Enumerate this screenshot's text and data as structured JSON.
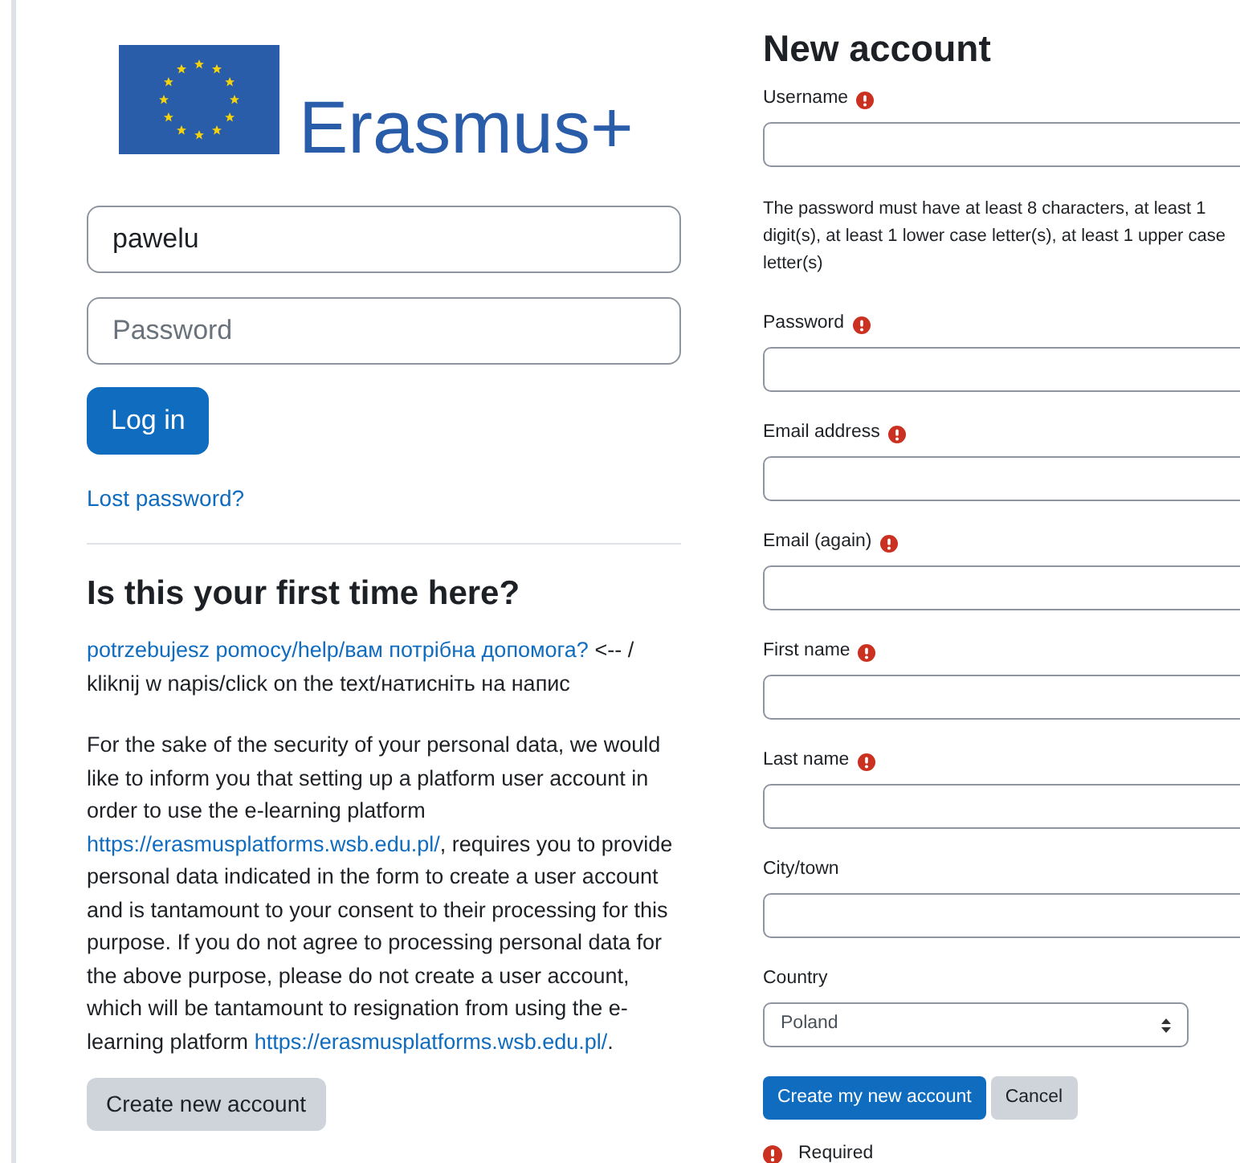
{
  "logo": {
    "text": "Erasmus+"
  },
  "login": {
    "username": {
      "value": "pawelu"
    },
    "password": {
      "placeholder": "Password"
    },
    "login_button": "Log in",
    "lost_password": "Lost password?"
  },
  "first_time": {
    "heading": "Is this your first time here?",
    "paragraphs": [
      [
        {
          "text": "potrzebujesz pomocy/help/вам потрібна допомога?",
          "link": true
        },
        {
          "text": " <-- / kliknij w napis/click on the text/натисніть на напис",
          "link": false
        }
      ],
      [
        {
          "text": "For the sake of the security of your personal data, we would like to inform you that setting up a platform user account in order to use the e-learning platform ",
          "link": false
        },
        {
          "text": "https://erasmusplatforms.wsb.edu.pl/",
          "link": true
        },
        {
          "text": ", requires you to provide personal data indicated in the form to create a user account and is tantamount to your consent to their processing for this purpose. If you do not agree to processing personal data for the above purpose, please do not create a user account, which will be tantamount to resignation from using the e-learning platform ",
          "link": false
        },
        {
          "text": "https://erasmusplatforms.wsb.edu.pl/",
          "link": true
        },
        {
          "text": ".",
          "link": false
        }
      ]
    ],
    "create_button": "Create new account"
  },
  "new_account": {
    "heading": "New account",
    "fields": [
      {
        "kind": "text",
        "label": "Username",
        "required": true
      },
      {
        "kind": "note",
        "text": "The password must have at least 8 characters, at least 1 digit(s), at least 1 lower case letter(s), at least 1 upper case letter(s)"
      },
      {
        "kind": "text",
        "label": "Password",
        "required": true
      },
      {
        "kind": "text",
        "label": "Email address",
        "required": true
      },
      {
        "kind": "text",
        "label": "Email (again)",
        "required": true
      },
      {
        "kind": "text",
        "label": "First name",
        "required": true
      },
      {
        "kind": "text",
        "label": "Last name",
        "required": true
      },
      {
        "kind": "text",
        "label": "City/town",
        "required": false
      },
      {
        "kind": "select",
        "label": "Country",
        "required": false,
        "value": "Poland"
      }
    ],
    "buttons": [
      {
        "label": "Create my new account",
        "primary": true
      },
      {
        "label": "Cancel",
        "primary": false
      }
    ],
    "legend": "Required"
  }
}
